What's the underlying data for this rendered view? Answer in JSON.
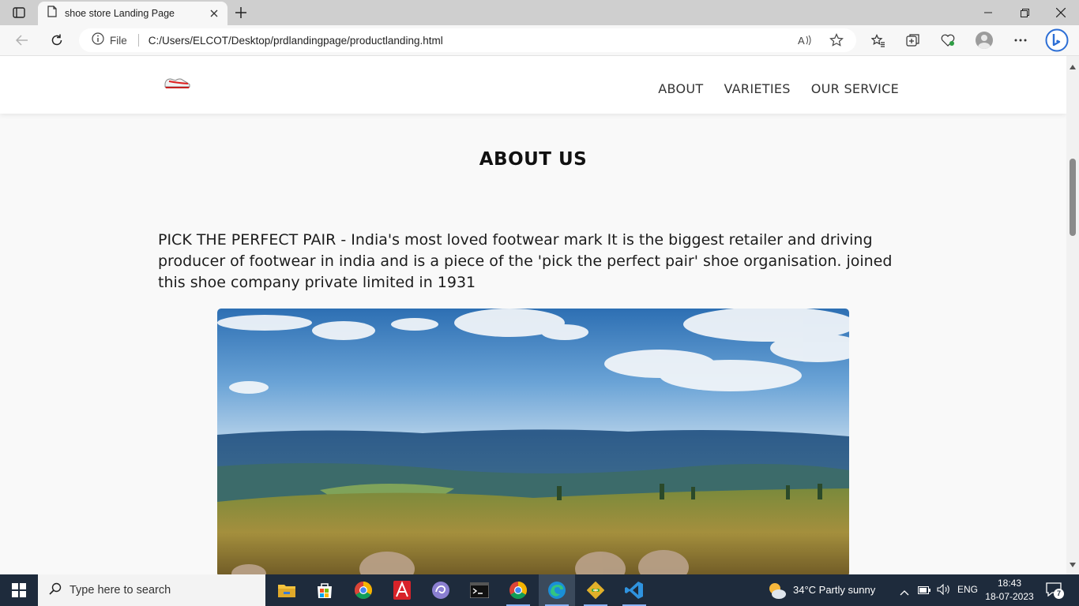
{
  "browser": {
    "tab_title": "shoe store Landing Page",
    "address_scheme_label": "File",
    "address_url": "C:/Users/ELCOT/Desktop/prdlandingpage/productlanding.html"
  },
  "site": {
    "nav": [
      "ABOUT",
      "VARIETIES",
      "OUR SERVICE"
    ],
    "section_title": "ABOUT US",
    "about_text": "PICK THE PERFECT PAIR - India's most loved footwear mark It is the biggest retailer and driving producer of footwear in india and is a piece of the 'pick the perfect pair' shoe organisation. joined this shoe company private limited in 1931"
  },
  "taskbar": {
    "search_placeholder": "Type here to search",
    "weather": "34°C  Partly sunny",
    "language": "ENG",
    "time": "18:43",
    "date": "18-07-2023",
    "notification_count": "7"
  },
  "colors": {
    "page_bg": "#f9f9f9",
    "header_bg": "#ffffff",
    "taskbar_bg": "#1e2b3c"
  }
}
